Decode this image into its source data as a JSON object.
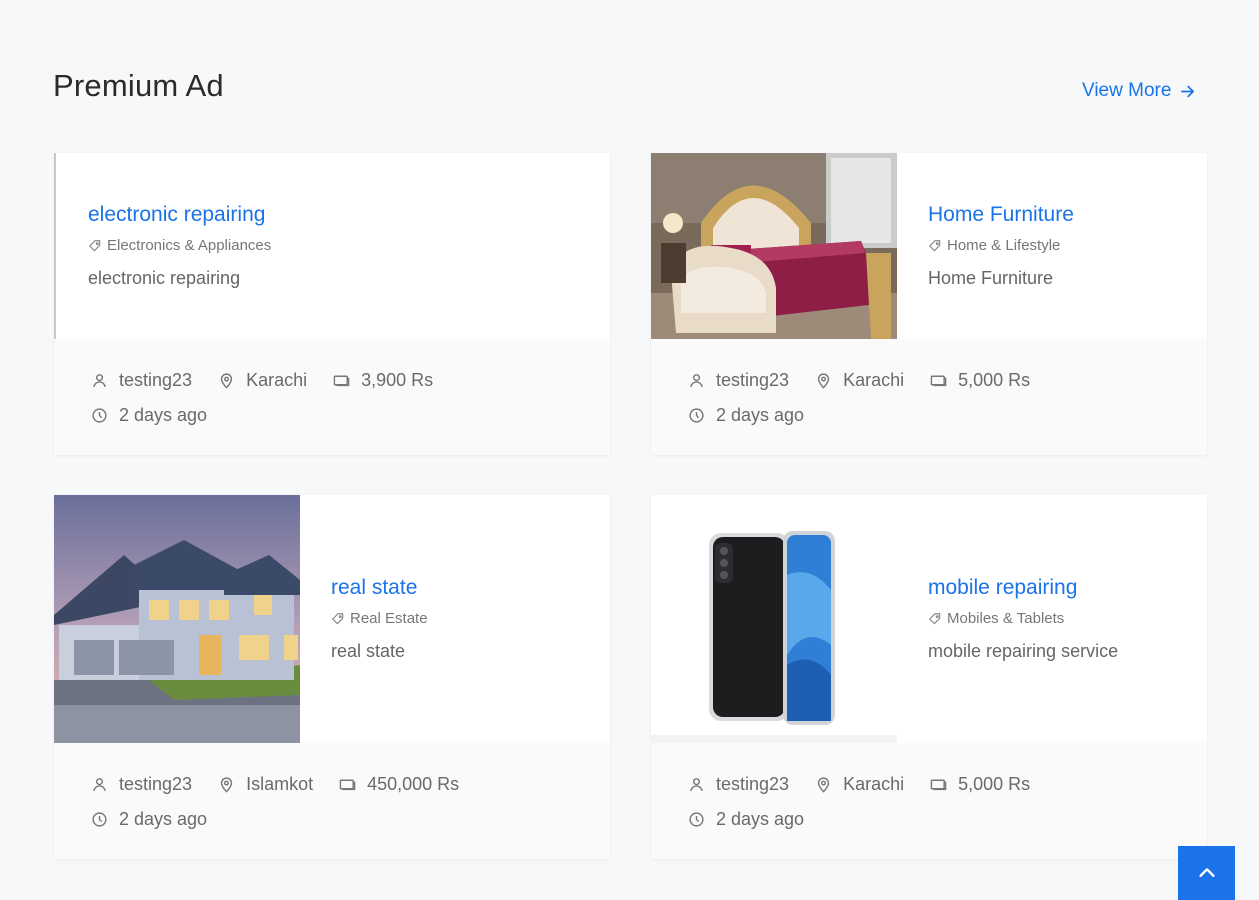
{
  "section": {
    "title": "Premium Ad",
    "view_more_label": "View More"
  },
  "ads": [
    {
      "title": "electronic repairing",
      "category": "Electronics & Appliances",
      "description": "electronic repairing",
      "user": "testing23",
      "location": "Karachi",
      "price": "3,900 Rs",
      "posted": "2 days ago"
    },
    {
      "title": "Home Furniture",
      "category": "Home & Lifestyle",
      "description": "Home Furniture",
      "user": "testing23",
      "location": "Karachi",
      "price": "5,000 Rs",
      "posted": "2 days ago"
    },
    {
      "title": "real state",
      "category": "Real Estate",
      "description": "real state",
      "user": "testing23",
      "location": "Islamkot",
      "price": "450,000 Rs",
      "posted": "2 days ago"
    },
    {
      "title": "mobile repairing",
      "category": "Mobiles & Tablets",
      "description": "mobile repairing service",
      "user": "testing23",
      "location": "Karachi",
      "price": "5,000 Rs",
      "posted": "2 days ago"
    }
  ],
  "colors": {
    "accent": "#1a73e8",
    "background": "#f7f8f9"
  }
}
